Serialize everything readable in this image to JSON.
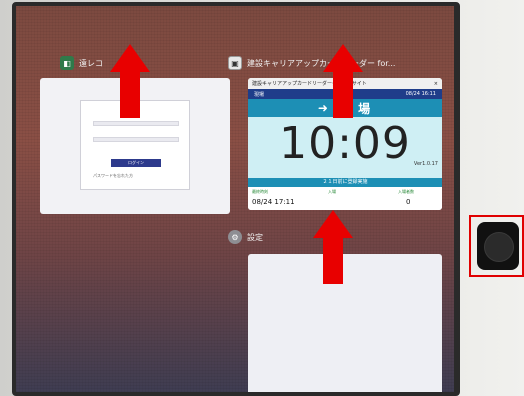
{
  "app_switcher": {
    "apps": [
      {
        "label": "遠レコ",
        "icon": "app-icon-green",
        "login_button": "ログイン",
        "login_link": "パスワードを忘れた方"
      },
      {
        "label": "建設キャリアアップカードリーダー for...",
        "icon": "card-reader-icon",
        "window_title": "建設キャリアアップカードリーダーグリーンサイト",
        "close": "×",
        "sub_left": "現場",
        "sub_mid": "",
        "sub_right": "08/24 16:11",
        "entry_label": "入 場",
        "time": "10:09",
        "version": "Ver1.0.17",
        "date_bar": "２１日前に登録実施",
        "foot": [
          {
            "label": "最終時刻",
            "value": "08/24 17:11"
          },
          {
            "label": "入場",
            "value": ""
          },
          {
            "label": "入場者数",
            "value": "0"
          }
        ]
      },
      {
        "label": "設定",
        "icon": "settings-gear-icon"
      }
    ]
  },
  "colors": {
    "arrow": "#e80000",
    "highlight_box": "#e00000",
    "entry_bar": "#1d8fb5"
  },
  "annotations": {
    "arrows": [
      "swipe-up-arrow",
      "swipe-up-arrow",
      "swipe-up-arrow"
    ],
    "highlight": "home-button"
  }
}
